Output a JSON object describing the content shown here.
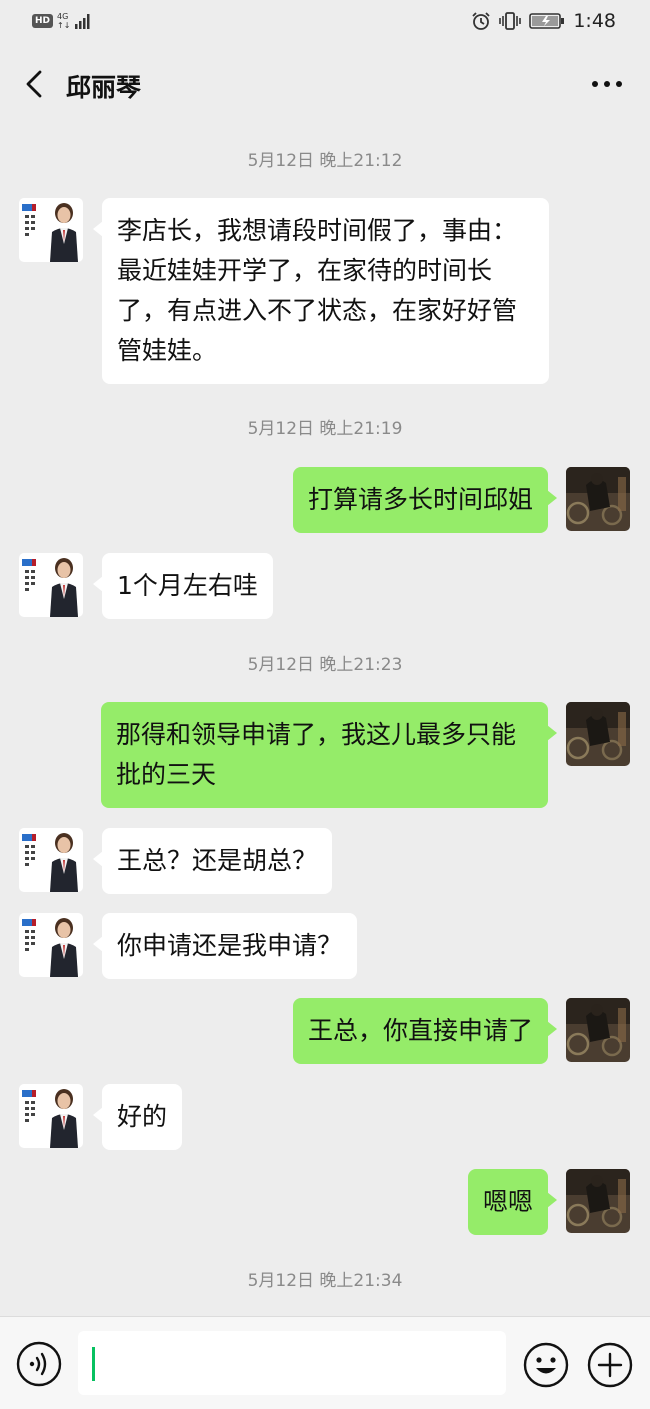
{
  "status_bar": {
    "hd": "HD",
    "network": "4G",
    "network_sub": "↑↓",
    "time": "1:48",
    "icons": [
      "alarm-icon",
      "vibrate-icon",
      "battery-icon"
    ]
  },
  "header": {
    "title": "邱丽琴",
    "back_icon": "chevron-left-icon",
    "more_icon": "more-icon"
  },
  "messages": [
    {
      "type": "timestamp",
      "text": "5月12日 晚上21:12"
    },
    {
      "type": "message",
      "from": "other",
      "text": "李店长，我想请段时间假了，事由：最近娃娃开学了，在家待的时间长了，有点进入不了状态，在家好好管管娃娃。"
    },
    {
      "type": "timestamp",
      "text": "5月12日 晚上21:19"
    },
    {
      "type": "message",
      "from": "me",
      "text": "打算请多长时间邱姐"
    },
    {
      "type": "message",
      "from": "other",
      "text": "1个月左右哇"
    },
    {
      "type": "timestamp",
      "text": "5月12日 晚上21:23"
    },
    {
      "type": "message",
      "from": "me",
      "text": "那得和领导申请了，我这儿最多只能批的三天"
    },
    {
      "type": "message",
      "from": "other",
      "text": "王总？还是胡总？"
    },
    {
      "type": "message",
      "from": "other",
      "text": "你申请还是我申请？"
    },
    {
      "type": "message",
      "from": "me",
      "text": "王总，你直接申请了"
    },
    {
      "type": "message",
      "from": "other",
      "text": "好的"
    },
    {
      "type": "message",
      "from": "me",
      "text": "嗯嗯"
    },
    {
      "type": "timestamp",
      "text": "5月12日 晚上21:34"
    }
  ],
  "input_bar": {
    "value": "",
    "icons": [
      "voice-icon",
      "emoji-icon",
      "plus-icon"
    ]
  },
  "colors": {
    "background": "#ededed",
    "outgoing_bubble": "#95ec69",
    "incoming_bubble": "#ffffff",
    "caret": "#07c160"
  }
}
